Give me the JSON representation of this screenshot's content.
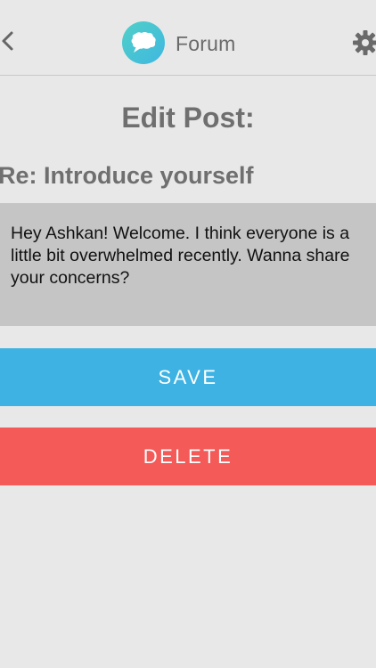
{
  "header": {
    "title": "Forum",
    "back_icon": "chevron-left-icon",
    "logo_icon": "speech-bubble-icon",
    "settings_icon": "gear-icon"
  },
  "page": {
    "title": "Edit Post:",
    "subject": "Re: Introduce yourself"
  },
  "post": {
    "body": "Hey Ashkan! Welcome. I think everyone is a little bit overwhelmed recently. Wanna share your concerns?"
  },
  "actions": {
    "save_label": "SAVE",
    "delete_label": "DELETE"
  },
  "colors": {
    "background": "#e8e8e8",
    "save": "#3db2e3",
    "delete": "#f35a58",
    "body_box": "#c5c5c5",
    "logo_gradient_start": "#4fd0c8",
    "logo_gradient_end": "#3fb7e0"
  }
}
